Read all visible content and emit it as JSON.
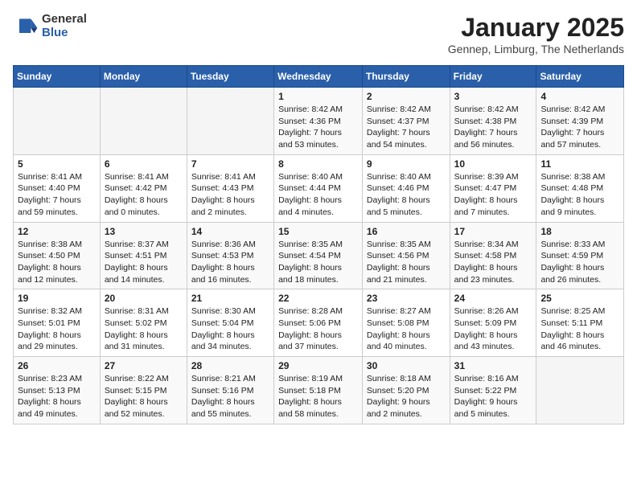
{
  "header": {
    "logo_general": "General",
    "logo_blue": "Blue",
    "month_title": "January 2025",
    "location": "Gennep, Limburg, The Netherlands"
  },
  "days_of_week": [
    "Sunday",
    "Monday",
    "Tuesday",
    "Wednesday",
    "Thursday",
    "Friday",
    "Saturday"
  ],
  "weeks": [
    [
      {
        "day": "",
        "info": ""
      },
      {
        "day": "",
        "info": ""
      },
      {
        "day": "",
        "info": ""
      },
      {
        "day": "1",
        "info": "Sunrise: 8:42 AM\nSunset: 4:36 PM\nDaylight: 7 hours and 53 minutes."
      },
      {
        "day": "2",
        "info": "Sunrise: 8:42 AM\nSunset: 4:37 PM\nDaylight: 7 hours and 54 minutes."
      },
      {
        "day": "3",
        "info": "Sunrise: 8:42 AM\nSunset: 4:38 PM\nDaylight: 7 hours and 56 minutes."
      },
      {
        "day": "4",
        "info": "Sunrise: 8:42 AM\nSunset: 4:39 PM\nDaylight: 7 hours and 57 minutes."
      }
    ],
    [
      {
        "day": "5",
        "info": "Sunrise: 8:41 AM\nSunset: 4:40 PM\nDaylight: 7 hours and 59 minutes."
      },
      {
        "day": "6",
        "info": "Sunrise: 8:41 AM\nSunset: 4:42 PM\nDaylight: 8 hours and 0 minutes."
      },
      {
        "day": "7",
        "info": "Sunrise: 8:41 AM\nSunset: 4:43 PM\nDaylight: 8 hours and 2 minutes."
      },
      {
        "day": "8",
        "info": "Sunrise: 8:40 AM\nSunset: 4:44 PM\nDaylight: 8 hours and 4 minutes."
      },
      {
        "day": "9",
        "info": "Sunrise: 8:40 AM\nSunset: 4:46 PM\nDaylight: 8 hours and 5 minutes."
      },
      {
        "day": "10",
        "info": "Sunrise: 8:39 AM\nSunset: 4:47 PM\nDaylight: 8 hours and 7 minutes."
      },
      {
        "day": "11",
        "info": "Sunrise: 8:38 AM\nSunset: 4:48 PM\nDaylight: 8 hours and 9 minutes."
      }
    ],
    [
      {
        "day": "12",
        "info": "Sunrise: 8:38 AM\nSunset: 4:50 PM\nDaylight: 8 hours and 12 minutes."
      },
      {
        "day": "13",
        "info": "Sunrise: 8:37 AM\nSunset: 4:51 PM\nDaylight: 8 hours and 14 minutes."
      },
      {
        "day": "14",
        "info": "Sunrise: 8:36 AM\nSunset: 4:53 PM\nDaylight: 8 hours and 16 minutes."
      },
      {
        "day": "15",
        "info": "Sunrise: 8:35 AM\nSunset: 4:54 PM\nDaylight: 8 hours and 18 minutes."
      },
      {
        "day": "16",
        "info": "Sunrise: 8:35 AM\nSunset: 4:56 PM\nDaylight: 8 hours and 21 minutes."
      },
      {
        "day": "17",
        "info": "Sunrise: 8:34 AM\nSunset: 4:58 PM\nDaylight: 8 hours and 23 minutes."
      },
      {
        "day": "18",
        "info": "Sunrise: 8:33 AM\nSunset: 4:59 PM\nDaylight: 8 hours and 26 minutes."
      }
    ],
    [
      {
        "day": "19",
        "info": "Sunrise: 8:32 AM\nSunset: 5:01 PM\nDaylight: 8 hours and 29 minutes."
      },
      {
        "day": "20",
        "info": "Sunrise: 8:31 AM\nSunset: 5:02 PM\nDaylight: 8 hours and 31 minutes."
      },
      {
        "day": "21",
        "info": "Sunrise: 8:30 AM\nSunset: 5:04 PM\nDaylight: 8 hours and 34 minutes."
      },
      {
        "day": "22",
        "info": "Sunrise: 8:28 AM\nSunset: 5:06 PM\nDaylight: 8 hours and 37 minutes."
      },
      {
        "day": "23",
        "info": "Sunrise: 8:27 AM\nSunset: 5:08 PM\nDaylight: 8 hours and 40 minutes."
      },
      {
        "day": "24",
        "info": "Sunrise: 8:26 AM\nSunset: 5:09 PM\nDaylight: 8 hours and 43 minutes."
      },
      {
        "day": "25",
        "info": "Sunrise: 8:25 AM\nSunset: 5:11 PM\nDaylight: 8 hours and 46 minutes."
      }
    ],
    [
      {
        "day": "26",
        "info": "Sunrise: 8:23 AM\nSunset: 5:13 PM\nDaylight: 8 hours and 49 minutes."
      },
      {
        "day": "27",
        "info": "Sunrise: 8:22 AM\nSunset: 5:15 PM\nDaylight: 8 hours and 52 minutes."
      },
      {
        "day": "28",
        "info": "Sunrise: 8:21 AM\nSunset: 5:16 PM\nDaylight: 8 hours and 55 minutes."
      },
      {
        "day": "29",
        "info": "Sunrise: 8:19 AM\nSunset: 5:18 PM\nDaylight: 8 hours and 58 minutes."
      },
      {
        "day": "30",
        "info": "Sunrise: 8:18 AM\nSunset: 5:20 PM\nDaylight: 9 hours and 2 minutes."
      },
      {
        "day": "31",
        "info": "Sunrise: 8:16 AM\nSunset: 5:22 PM\nDaylight: 9 hours and 5 minutes."
      },
      {
        "day": "",
        "info": ""
      }
    ]
  ]
}
